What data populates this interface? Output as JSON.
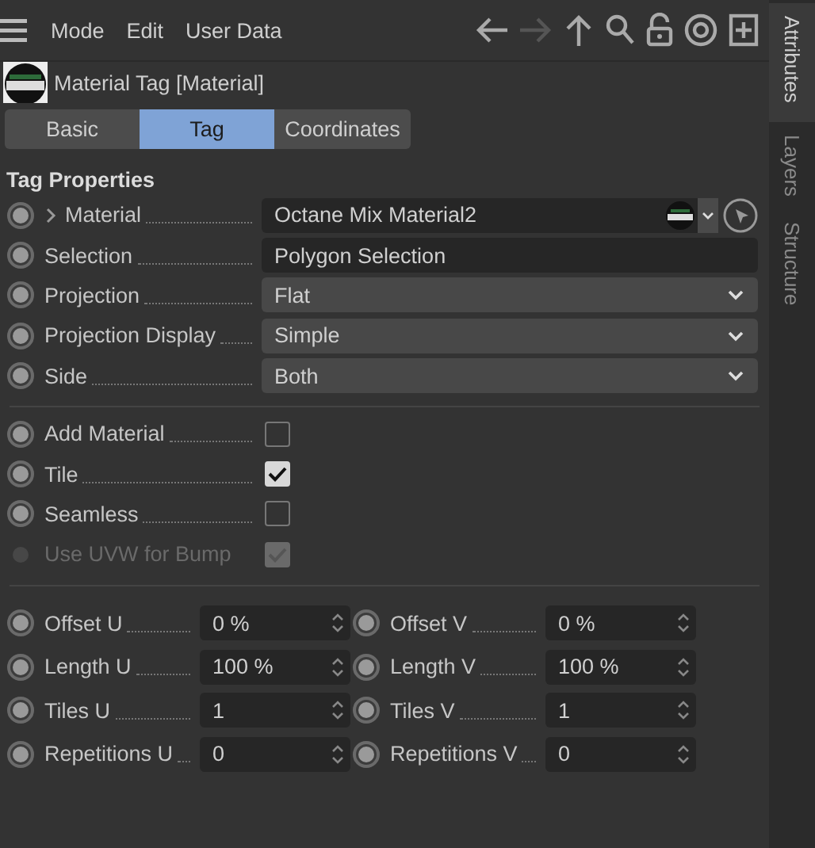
{
  "menu": [
    {
      "label": "Mode"
    },
    {
      "label": "Edit"
    },
    {
      "label": "User Data"
    }
  ],
  "header": {
    "title": "Material Tag [Material]"
  },
  "tabs": [
    {
      "label": "Basic",
      "selected": false
    },
    {
      "label": "Tag",
      "selected": true
    },
    {
      "label": "Coordinates",
      "selected": false
    }
  ],
  "side_tabs": [
    {
      "label": "Attributes",
      "selected": true
    },
    {
      "label": "Layers",
      "selected": false
    },
    {
      "label": "Structure",
      "selected": false
    }
  ],
  "section_title": "Tag Properties",
  "properties": [
    {
      "kind": "link",
      "label": "Material",
      "value": "Octane Mix Material2",
      "expandable": true
    },
    {
      "kind": "text",
      "label": "Selection",
      "value": "Polygon Selection"
    },
    {
      "kind": "dropdown",
      "label": "Projection",
      "value": "Flat"
    },
    {
      "kind": "dropdown",
      "label": "Projection Display",
      "value": "Simple"
    },
    {
      "kind": "dropdown",
      "label": "Side",
      "value": "Both"
    }
  ],
  "options": [
    {
      "label": "Add Material",
      "checked": false,
      "disabled": false
    },
    {
      "label": "Tile",
      "checked": true,
      "disabled": false
    },
    {
      "label": "Seamless",
      "checked": false,
      "disabled": false
    },
    {
      "label": "Use UVW for Bump",
      "checked": true,
      "disabled": true
    }
  ],
  "transform_rows": [
    {
      "left": {
        "label": "Offset U",
        "value": "0 %"
      },
      "right": {
        "label": "Offset V",
        "value": "0 %"
      }
    },
    {
      "left": {
        "label": "Length U",
        "value": "100 %"
      },
      "right": {
        "label": "Length V",
        "value": "100 %"
      }
    },
    {
      "left": {
        "label": "Tiles U",
        "value": "1"
      },
      "right": {
        "label": "Tiles V",
        "value": "1"
      }
    },
    {
      "left": {
        "label": "Repetitions U",
        "value": "0"
      },
      "right": {
        "label": "Repetitions V",
        "value": "0"
      }
    }
  ]
}
